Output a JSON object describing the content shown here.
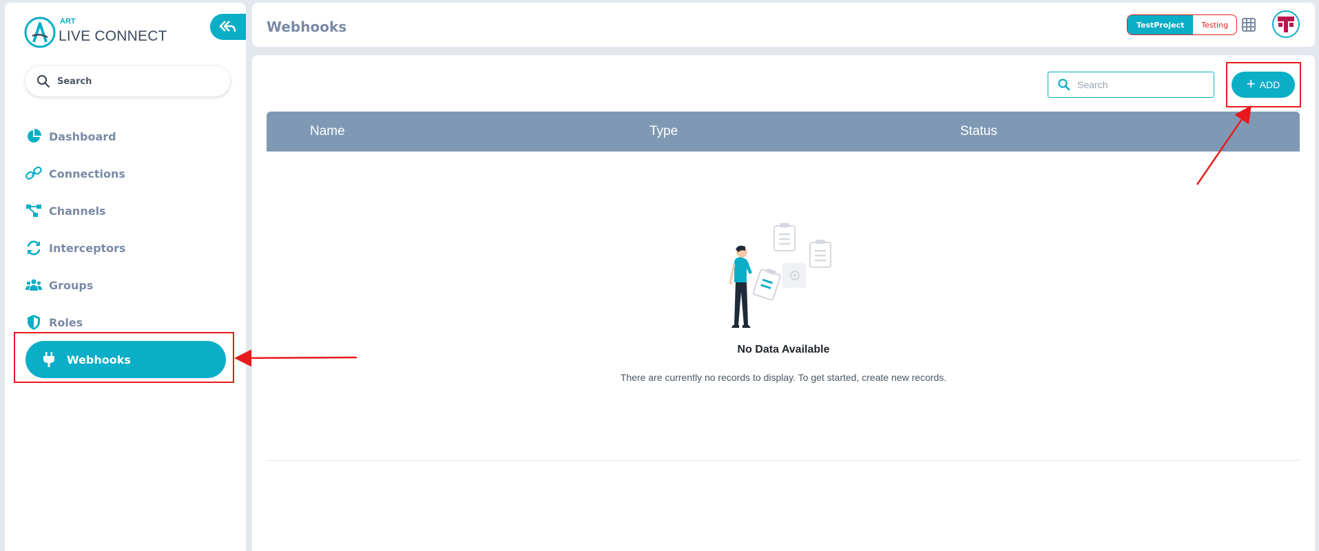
{
  "app": {
    "logo_small": "ART",
    "logo_name": "LIVE CONNECT"
  },
  "sidebar": {
    "search_placeholder": "Search",
    "items": [
      {
        "label": "Dashboard",
        "icon": "pie-chart-icon"
      },
      {
        "label": "Connections",
        "icon": "link-icon"
      },
      {
        "label": "Channels",
        "icon": "channels-icon"
      },
      {
        "label": "Interceptors",
        "icon": "refresh-icon"
      },
      {
        "label": "Groups",
        "icon": "users-icon"
      },
      {
        "label": "Roles",
        "icon": "shield-icon"
      },
      {
        "label": "Webhooks",
        "icon": "plug-icon",
        "active": true
      }
    ]
  },
  "header": {
    "title": "Webhooks",
    "project_active": "TestProject",
    "project_other": "Testing"
  },
  "main": {
    "search_placeholder": "Search",
    "add_label": "ADD",
    "columns": [
      "Name",
      "Type",
      "Status"
    ],
    "empty_title": "No Data Available",
    "empty_description": "There are currently no records to display. To get started, create new records."
  },
  "colors": {
    "accent": "#0aaec7",
    "nav_text": "#7a8aa6",
    "table_header": "#7f99b5",
    "annotation_red": "#e8191c"
  }
}
